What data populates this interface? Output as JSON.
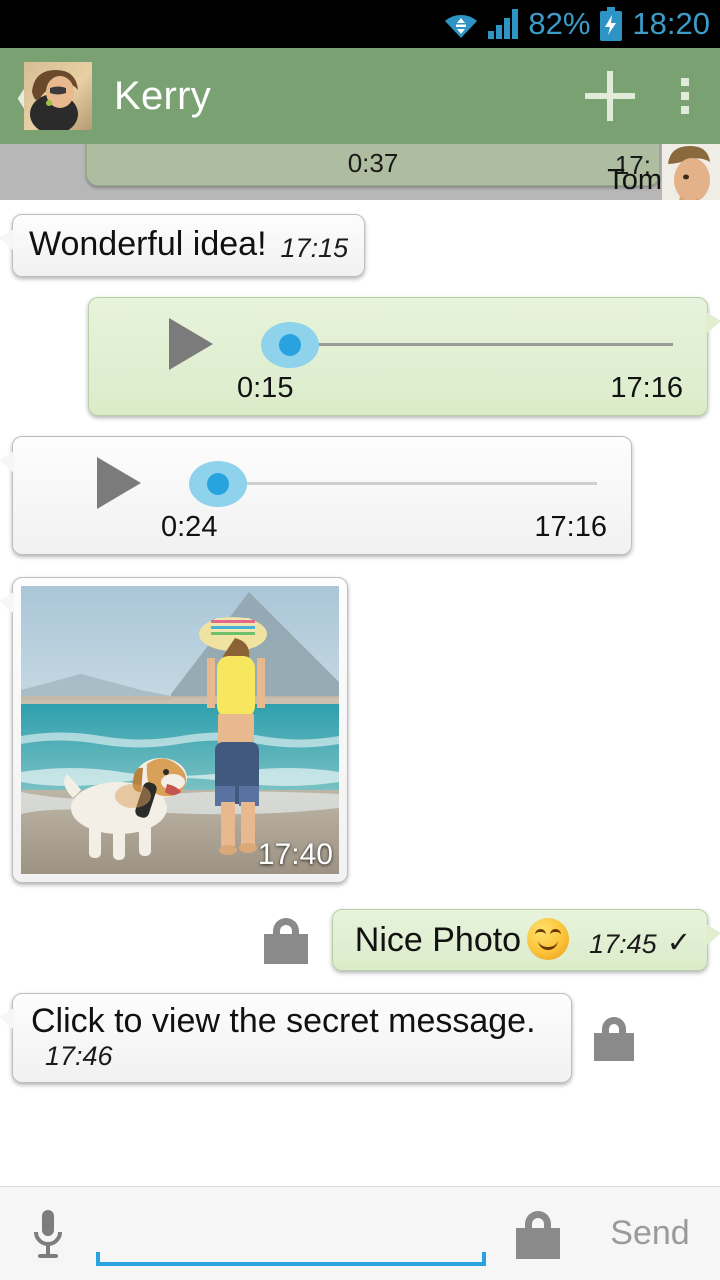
{
  "status_bar": {
    "wifi_icon": "wifi-icon",
    "signal_icon": "signal-bars-icon",
    "battery_percent": "82%",
    "battery_icon": "battery-charging-icon",
    "clock": "18:20",
    "text_color": "#3c9cc8",
    "background": "#000000"
  },
  "header": {
    "back_icon": "back-chevron-icon",
    "avatar": "contact-avatar",
    "title": "Kerry",
    "add_icon": "plus-icon",
    "overflow_icon": "overflow-menu-icon",
    "background": "#7aa172"
  },
  "chat": {
    "partial_message": {
      "duration": "0:37",
      "time": "17:",
      "sender_name": "Tom",
      "selected": true
    },
    "messages": [
      {
        "id": "m1",
        "type": "text",
        "direction": "in",
        "text": "Wonderful idea!",
        "time": "17:15"
      },
      {
        "id": "m2",
        "type": "audio",
        "direction": "out",
        "duration": "0:15",
        "time": "17:16",
        "play_icon": "play-icon",
        "progress": 0
      },
      {
        "id": "m3",
        "type": "audio",
        "direction": "in",
        "duration": "0:24",
        "time": "17:16",
        "play_icon": "play-icon",
        "progress": 0
      },
      {
        "id": "m4",
        "type": "photo",
        "direction": "in",
        "caption_time": "17:40",
        "alt": "woman walking a dog on the beach"
      },
      {
        "id": "m5",
        "type": "text",
        "direction": "out",
        "text": "Nice Photo",
        "emoji": "smiling-face-emoji",
        "time": "17:45",
        "tick": "✓",
        "lock_icon": "lock-icon"
      },
      {
        "id": "m6",
        "type": "text",
        "direction": "in",
        "text": "Click to view the secret message.",
        "time": "17:46",
        "lock_icon": "lock-icon"
      }
    ]
  },
  "input_bar": {
    "mic_icon": "microphone-icon",
    "input_value": "",
    "input_placeholder": "",
    "lock_icon": "lock-icon",
    "send_label": "Send"
  },
  "colors": {
    "header_green": "#7aa172",
    "bubble_out_green": "#e0efd4",
    "bubble_in_gray": "#f4f4f4",
    "accent_blue": "#29a3e0",
    "slider_thumb": "#29a3e0",
    "slider_halo": "#8fd2ec"
  }
}
